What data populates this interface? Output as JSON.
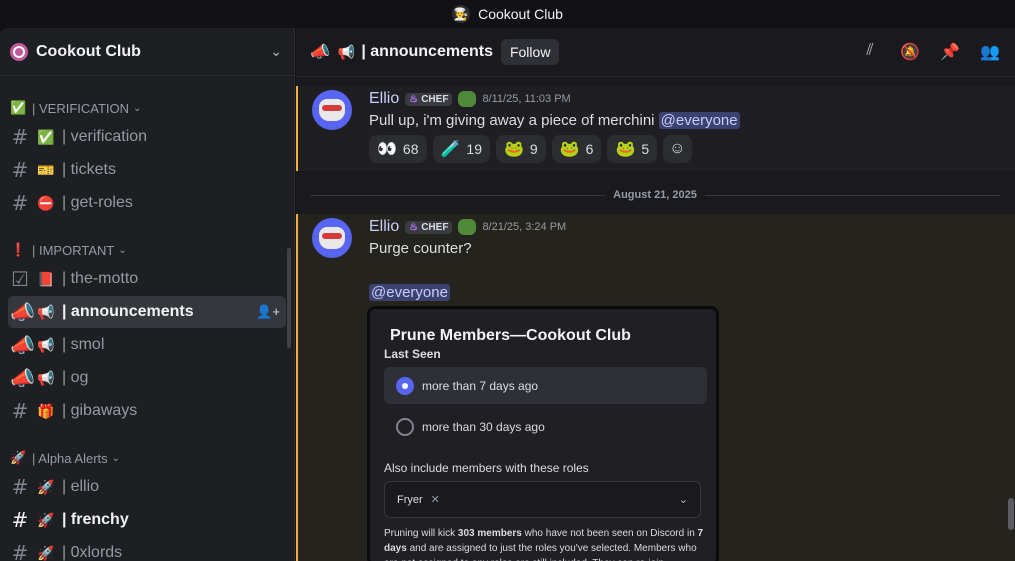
{
  "window": {
    "title": "Cookout Club",
    "icon": "chef-avatar-icon"
  },
  "sidebar": {
    "server_name": "Cookout Club",
    "categories": [
      {
        "label": "| VERIFICATION",
        "emoji": "✅",
        "channels": [
          {
            "emoji": "✅",
            "label": "| verification"
          },
          {
            "emoji": "🎫",
            "label": "| tickets"
          },
          {
            "emoji": "⛔",
            "label": "| get-roles"
          }
        ]
      },
      {
        "label": "| IMPORTANT",
        "emoji": "❗",
        "channels": [
          {
            "emoji": "📕",
            "label": "| the-motto"
          },
          {
            "emoji": "📢",
            "label": "| announcements"
          },
          {
            "emoji": "📢",
            "label": "| smol"
          },
          {
            "emoji": "📢",
            "label": "| og"
          },
          {
            "emoji": "🎁",
            "label": "| gibaways"
          }
        ]
      },
      {
        "label": "| Alpha Alerts",
        "emoji": "🚀",
        "channels": [
          {
            "emoji": "🚀",
            "label": "| ellio"
          },
          {
            "emoji": "🚀",
            "label": "| frenchy"
          },
          {
            "emoji": "🚀",
            "label": "| 0xlords"
          }
        ]
      }
    ]
  },
  "header": {
    "emoji": "📢",
    "channel_name": "| announcements",
    "follow_label": "Follow"
  },
  "messages": [
    {
      "author": "Ellio",
      "tag": "CHEF",
      "timestamp": "8/11/25, 11:03 PM",
      "text": "Pull up, i'm giving away a piece of merchini",
      "mention": "@everyone",
      "reactions": [
        {
          "emoji": "👀",
          "count": "68"
        },
        {
          "emoji": "🧪",
          "count": "19"
        },
        {
          "emoji": "🐸",
          "count": "9"
        },
        {
          "emoji": "🐸",
          "count": "6"
        },
        {
          "emoji": "🐸",
          "count": "5"
        }
      ]
    },
    {
      "author": "Ellio",
      "tag": "CHEF",
      "timestamp": "8/21/25, 3:24 PM",
      "text": "Purge counter?",
      "mention": "@everyone"
    }
  ],
  "divider": "August 21, 2025",
  "embed": {
    "title": "Prune Members—Cookout Club",
    "last_seen": "Last Seen",
    "options": [
      "more than 7 days ago",
      "more than 30 days ago"
    ],
    "roles_label": "Also include members with these roles",
    "selected_role": "Fryer",
    "desc_pre": "Pruning will kick ",
    "desc_count": "303 members",
    "desc_mid": " who have not been seen on Discord in ",
    "desc_days": "7 days",
    "desc_post": " and are assigned to just the roles you've selected. Members who are not assigned to any roles are still included. They can re-join"
  },
  "colors": {
    "accent": "#5865f2",
    "highlight_bar": "#f0b232",
    "mention_bg": "#3c4270"
  }
}
